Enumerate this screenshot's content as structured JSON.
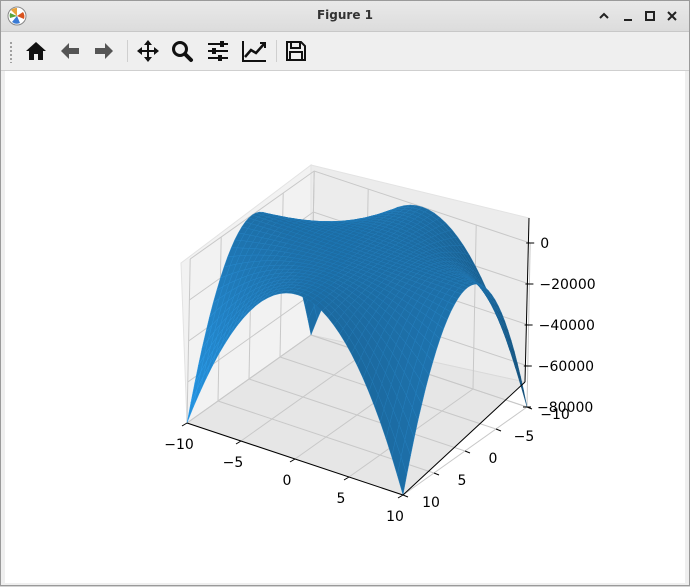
{
  "window": {
    "title": "Figure 1"
  },
  "toolbar": {
    "items": [
      {
        "name": "home-button",
        "icon": "home-icon",
        "tooltip": "Reset original view"
      },
      {
        "name": "back-button",
        "icon": "arrow-left-icon",
        "tooltip": "Back"
      },
      {
        "name": "forward-button",
        "icon": "arrow-right-icon",
        "tooltip": "Forward"
      },
      {
        "name": "pan-button",
        "icon": "move-icon",
        "tooltip": "Pan"
      },
      {
        "name": "zoom-button",
        "icon": "zoom-icon",
        "tooltip": "Zoom"
      },
      {
        "name": "configure-subplots-button",
        "icon": "sliders-icon",
        "tooltip": "Subplots"
      },
      {
        "name": "edit-axis-button",
        "icon": "line-chart-icon",
        "tooltip": "Customize"
      },
      {
        "name": "save-button",
        "icon": "save-icon",
        "tooltip": "Save"
      }
    ]
  },
  "chart_data": {
    "type": "surface3d",
    "surface_color": "#1f77b4",
    "x_ticks": [
      "−10",
      "−5",
      "0",
      "5",
      "10"
    ],
    "y_ticks": [
      "−10",
      "−5",
      "0",
      "5",
      "10"
    ],
    "z_ticks": [
      "0",
      "−20000",
      "−40000",
      "−60000",
      "−80000"
    ],
    "xlim": [
      -10,
      10
    ],
    "ylim": [
      -10,
      10
    ],
    "zlim": [
      -80000,
      0
    ],
    "grid": true
  }
}
